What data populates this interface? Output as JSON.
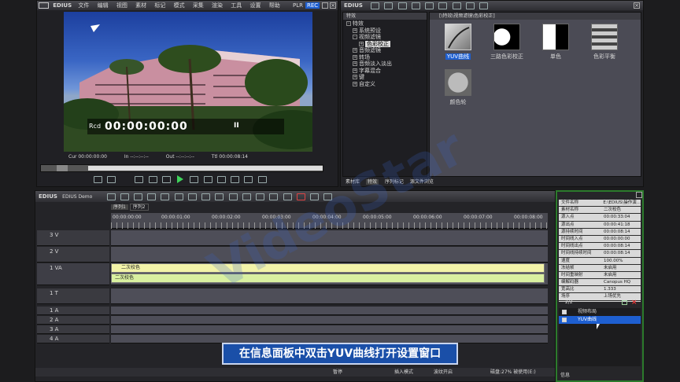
{
  "player": {
    "brand": "EDIUS",
    "menu": [
      "文件",
      "编辑",
      "视图",
      "素材",
      "标记",
      "模式",
      "采集",
      "渲染",
      "工具",
      "设置",
      "帮助"
    ],
    "plr": "PLR",
    "rec": "REC",
    "tc_label": "Rcd",
    "timecode": "00:00:00:00",
    "pause_glyph": "II",
    "status": {
      "cur": "Cur 00:00:00:00",
      "in": "In --:--:--:--",
      "out": "Out --:--:--:--",
      "ttl": "Ttl 00:00:08:14"
    }
  },
  "effects_panel": {
    "brand": "EDIUS",
    "tree_header": "特效",
    "tree": [
      {
        "label": "特效",
        "level": 0
      },
      {
        "label": "系统预设",
        "level": 1
      },
      {
        "label": "视频滤镜",
        "level": 1
      },
      {
        "label": "色彩校正",
        "level": 2,
        "selected": true
      },
      {
        "label": "音频滤镜",
        "level": 1
      },
      {
        "label": "转场",
        "level": 1
      },
      {
        "label": "音频淡入淡出",
        "level": 1
      },
      {
        "label": "字幕混合",
        "level": 1
      },
      {
        "label": "键",
        "level": 1
      },
      {
        "label": "自定义",
        "level": 1
      }
    ],
    "path": "[\\特效\\视频滤镜\\色彩校正]",
    "items": [
      {
        "label": "YUV曲线",
        "selected": true
      },
      {
        "label": "三路色彩校正"
      },
      {
        "label": "单色"
      },
      {
        "label": "色彩平衡"
      },
      {
        "label": "颜色轮"
      }
    ],
    "tabs": [
      "素材库",
      "特效",
      "序列标记",
      "源文件浏览"
    ]
  },
  "timeline": {
    "brand": "EDIUS",
    "project": "EDIUS Demo",
    "seq_tabs": [
      "序列1",
      "序列2"
    ],
    "ruler": [
      "00:00:00:00",
      "00:00:01:00",
      "00:00:02:00",
      "00:00:03:00",
      "00:00:04:00",
      "00:00:05:00",
      "00:00:06:00",
      "00:00:07:00",
      "00:00:08:00"
    ],
    "tracks": [
      {
        "name": "3 V"
      },
      {
        "name": "2 V"
      },
      {
        "name": "1 VA"
      },
      {
        "name": "1 T"
      },
      {
        "name": "1 A"
      },
      {
        "name": "2 A"
      },
      {
        "name": "3 A"
      },
      {
        "name": "4 A"
      }
    ],
    "clip_name": "二次校色",
    "clip_sub": "二次校色",
    "status_items": [
      "暂停",
      "插入模式",
      "波纹开启",
      "磁盘:27% 被使用(E:)"
    ]
  },
  "info_panel": {
    "props": [
      [
        "文件名称",
        "E:\\EDIUS\\操作演..."
      ],
      [
        "素材名称",
        "二次校色"
      ],
      [
        "源入点",
        "00:00:33:04"
      ],
      [
        "源出点",
        "00:00:41:18"
      ],
      [
        "源持续时间",
        "00:00:08:14"
      ],
      [
        "时间线入点",
        "00:00:00:00"
      ],
      [
        "时间线出点",
        "00:00:08:14"
      ],
      [
        "时间线持续时间",
        "00:00:08:14"
      ],
      [
        "速度",
        "100.00%"
      ],
      [
        "冻结帧",
        "未启用"
      ],
      [
        "时间重映射",
        "未启用"
      ],
      [
        "编解码器",
        "Canopus HQ"
      ],
      [
        "宽高比",
        "1.333"
      ],
      [
        "场序",
        "上场优先"
      ]
    ],
    "count": "2/2",
    "filters": [
      "视频布局",
      "YUV曲线"
    ],
    "footer_tab": "信息"
  },
  "caption": "在信息面板中双击YUV曲线打开设置窗口",
  "watermark": "VideoStar",
  "colors": {
    "accent": "#1e5fd0",
    "clip": "#f2f3a8",
    "caption_bg": "#1a4fa8"
  }
}
